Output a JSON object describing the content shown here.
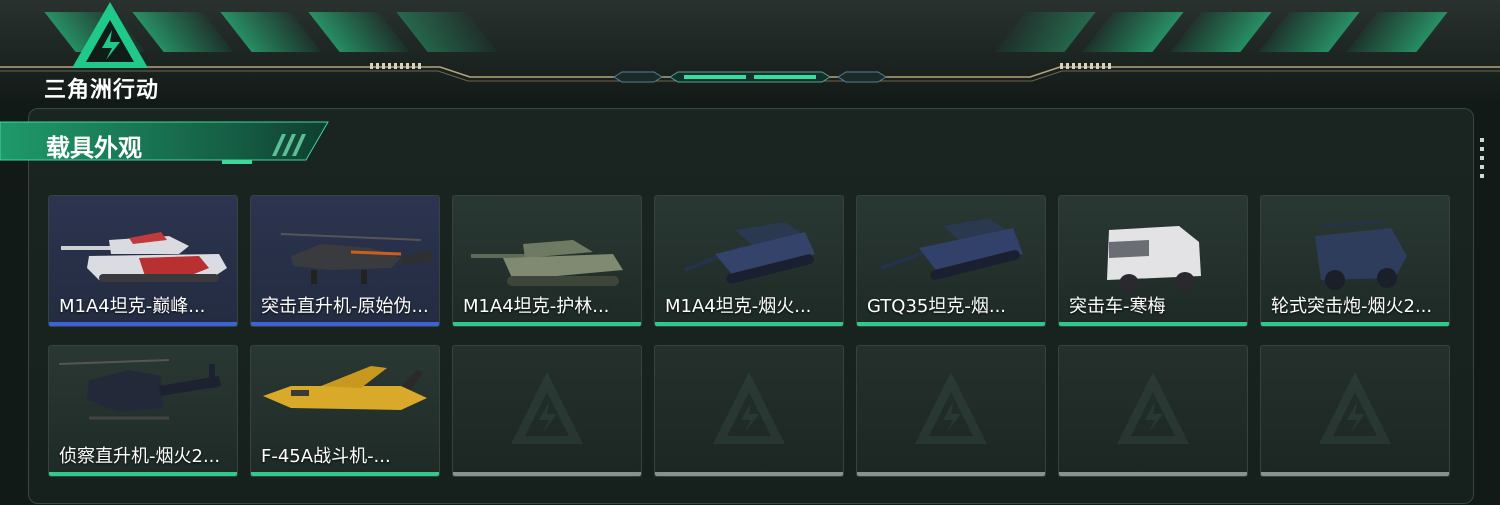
{
  "brand": {
    "name": "三角洲行动"
  },
  "section": {
    "title": "载具外观"
  },
  "colors": {
    "accent_green": "#2fc98b",
    "accent_blue": "#3b63d6",
    "empty_bar": "#8a918f"
  },
  "vehicles": [
    {
      "label": "M1A4坦克-巅峰...",
      "rarity_color": "#3b63d6",
      "icon": "tank-icon"
    },
    {
      "label": "突击直升机-原始伪...",
      "rarity_color": "#3b63d6",
      "icon": "helicopter-icon"
    },
    {
      "label": "M1A4坦克-护林...",
      "rarity_color": "#2fc98b",
      "icon": "tank-icon"
    },
    {
      "label": "M1A4坦克-烟火...",
      "rarity_color": "#2fc98b",
      "icon": "tank-icon"
    },
    {
      "label": "GTQ35坦克-烟...",
      "rarity_color": "#2fc98b",
      "icon": "tank-icon"
    },
    {
      "label": "突击车-寒梅",
      "rarity_color": "#2fc98b",
      "icon": "armored-car-icon"
    },
    {
      "label": "轮式突击炮-烟火2...",
      "rarity_color": "#2fc98b",
      "icon": "armored-car-icon"
    },
    {
      "label": "侦察直升机-烟火2...",
      "rarity_color": "#2fc98b",
      "icon": "helicopter-icon"
    },
    {
      "label": "F-45A战斗机-...",
      "rarity_color": "#2fc98b",
      "icon": "jet-icon"
    }
  ],
  "empty_slots": 5
}
